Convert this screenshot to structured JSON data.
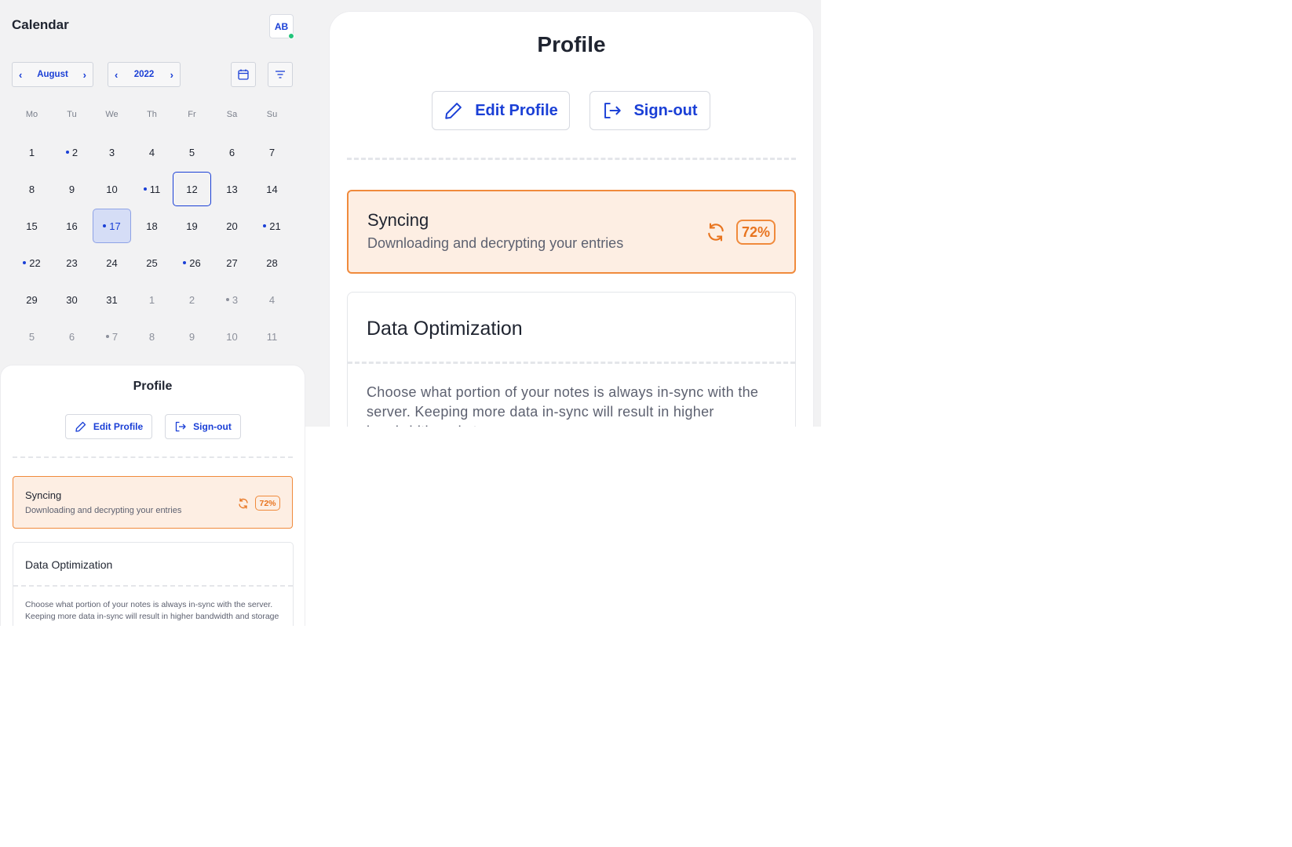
{
  "calendar": {
    "title": "Calendar",
    "avatar_initials": "AB",
    "avatar_status": "online",
    "month": "August",
    "year": "2022",
    "weekdays": [
      "Mo",
      "Tu",
      "We",
      "Th",
      "Fr",
      "Sa",
      "Su"
    ],
    "today": "12",
    "selected": "17",
    "weeks": [
      [
        {
          "d": "1"
        },
        {
          "d": "2",
          "dot": true
        },
        {
          "d": "3"
        },
        {
          "d": "4"
        },
        {
          "d": "5"
        },
        {
          "d": "6"
        },
        {
          "d": "7"
        }
      ],
      [
        {
          "d": "8"
        },
        {
          "d": "9"
        },
        {
          "d": "10"
        },
        {
          "d": "11",
          "dot": true
        },
        {
          "d": "12",
          "today": true
        },
        {
          "d": "13"
        },
        {
          "d": "14"
        }
      ],
      [
        {
          "d": "15"
        },
        {
          "d": "16"
        },
        {
          "d": "17",
          "dot": true,
          "selected": true
        },
        {
          "d": "18"
        },
        {
          "d": "19"
        },
        {
          "d": "20"
        },
        {
          "d": "21",
          "dot": true
        }
      ],
      [
        {
          "d": "22",
          "dot": true
        },
        {
          "d": "23"
        },
        {
          "d": "24"
        },
        {
          "d": "25"
        },
        {
          "d": "26",
          "dot": true
        },
        {
          "d": "27"
        },
        {
          "d": "28"
        }
      ],
      [
        {
          "d": "29"
        },
        {
          "d": "30"
        },
        {
          "d": "31"
        },
        {
          "d": "1",
          "muted": true
        },
        {
          "d": "2",
          "muted": true
        },
        {
          "d": "3",
          "muted": true,
          "dot": true
        },
        {
          "d": "4",
          "muted": true
        }
      ],
      [
        {
          "d": "5",
          "muted": true
        },
        {
          "d": "6",
          "muted": true
        },
        {
          "d": "7",
          "muted": true,
          "dot": true
        },
        {
          "d": "8",
          "muted": true
        },
        {
          "d": "9",
          "muted": true
        },
        {
          "d": "10",
          "muted": true
        },
        {
          "d": "11",
          "muted": true
        }
      ]
    ]
  },
  "profile": {
    "title": "Profile",
    "edit_label": "Edit Profile",
    "signout_label": "Sign-out",
    "sync": {
      "title": "Syncing",
      "subtitle": "Downloading and decrypting your entries",
      "percent": "72%"
    },
    "optimization": {
      "title": "Data Optimization",
      "text": "Choose what portion of your notes is always in-sync with the server. Keeping more data in-sync will result in higher bandwidth and storage usage."
    }
  },
  "colors": {
    "accent": "#1a3fd6",
    "sync_bg": "#fdeee3",
    "sync_border": "#f08a3c",
    "online": "#22c37a"
  },
  "icons": {
    "edit": "pencil-icon",
    "signout": "sign-out-icon",
    "sync": "sync-icon",
    "calendar": "calendar-icon",
    "filter": "filter-icon"
  }
}
